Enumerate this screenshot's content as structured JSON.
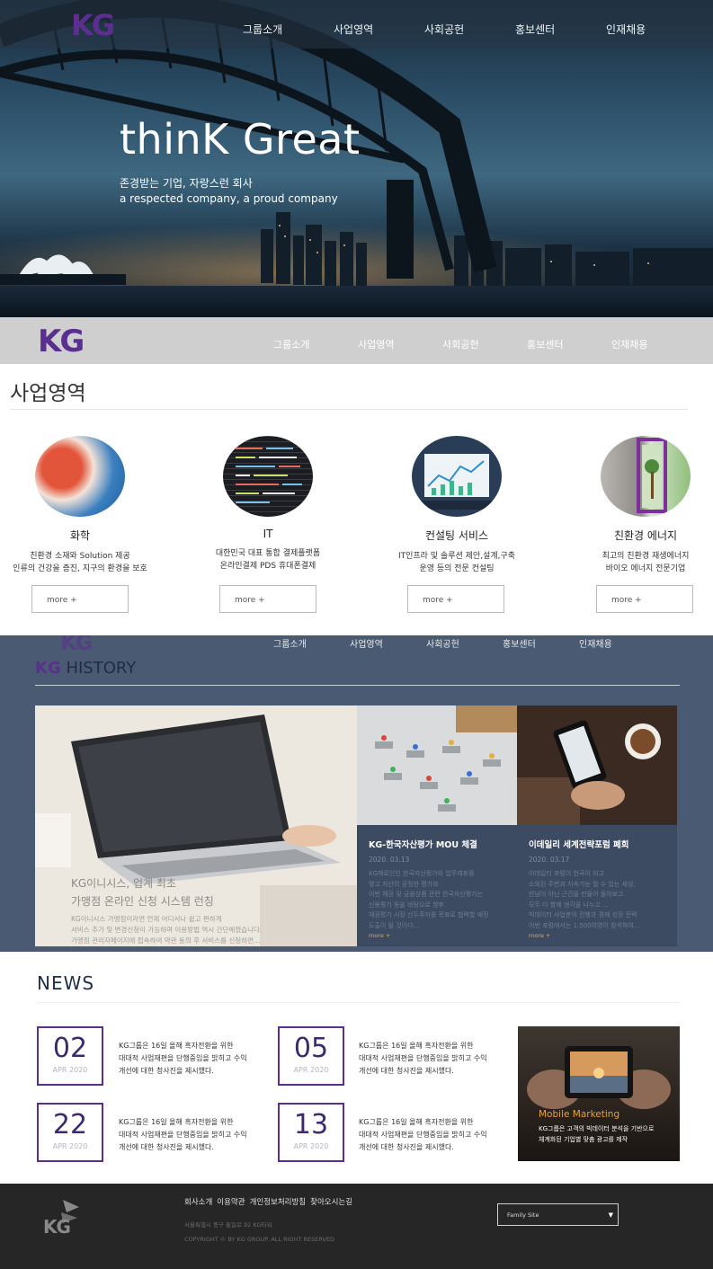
{
  "nav": {
    "logo": "KG",
    "items": [
      "그룹소개",
      "사업영역",
      "사회공헌",
      "홍보센터",
      "인재채용"
    ]
  },
  "hero": {
    "title": "thinK Great",
    "subtitle_ko": "존경받는 기업, 자랑스런 회사",
    "subtitle_en": "a respected company, a proud company"
  },
  "business": {
    "title": "사업영역",
    "items": [
      {
        "name": "화학",
        "desc1": "친환경 소재와 Solution 제공",
        "desc2": "인류의 건강을 증진, 지구의 환경을 보호",
        "more": "more +"
      },
      {
        "name": "IT",
        "desc1": "대한민국 대표 통합 결제플랫폼",
        "desc2": "온라인결제 PDS 휴대폰결제",
        "more": "more +"
      },
      {
        "name": "컨설팅 서비스",
        "desc1": "IT인프라 및 솔루션 제안,설계,구축",
        "desc2": "운영 등의 전문 컨설팅",
        "more": "more +"
      },
      {
        "name": "친환경 에너지",
        "desc1": "최고의 친환경 재생에너지",
        "desc2": "바이오 에너지 전문기업",
        "more": "more +"
      }
    ]
  },
  "history": {
    "title_kg": "KG",
    "title_rest": " HISTORY",
    "main": {
      "title1": "KG이니시스, 업계 최초",
      "title2": "가맹점 온라인 신청 시스템 런칭",
      "text1": "KG이니시스 가맹점이라면 언제 어디서나 쉽고 편하게",
      "text2": "서비스 추가 및 변경신청이 가능하며 이용방법 역시 간단해졌습니다.",
      "text3": "가맹점 관리자페이지에 접속하여 약관 동의 후 서비스를 신청하면..."
    },
    "cards": [
      {
        "title": "KG-한국자산평가 MOU 체결",
        "date": "2020. 03.13",
        "text1": "KG제로인인 한국자산평가와 업무제휴를",
        "text2": "맺고 자산의 공정한 평가와",
        "text3": "이번 채권 및 금융상품 관련 한국자산평가는",
        "text4": "신용평가 등을 바탕으로 향후",
        "text5": "채권평가 시장 선두주자를 목표로 협력할 예정",
        "text6": "도출이 될 것이다...",
        "more": "more +"
      },
      {
        "title": "이데일리 세계전략포럼 폐회",
        "date": "2020. 03.17",
        "text1": "이데일리 포럼이 한국이 되고",
        "text2": "소외된 주변과 지속가능 할 수 있는 세상,",
        "text3": "만남이 아닌 근간을 만들어 돌아보고",
        "text4": "모두 다 함께 생각을 나누고 ...",
        "text5": "빅데이터 사업분야 진행과 경제 성장 전략",
        "text6": "이번 포럼에서는 1,500여명이 참석하여...",
        "more": "more +"
      }
    ]
  },
  "news": {
    "title": "NEWS",
    "items": [
      {
        "day": "02",
        "month": "APR 2020",
        "text1": "KG그룹은 16일 올해 흑자전환을 위한",
        "text2": "대대적 사업재편을 단행중임을 밝히고 수익",
        "text3": "개선에 대한 청사진을 제시했다."
      },
      {
        "day": "05",
        "month": "APR 2020",
        "text1": "KG그룹은 16일 올해 흑자전환을 위한",
        "text2": "대대적 사업재편을 단행중임을 밝히고 수익",
        "text3": "개선에 대한 청사진을 제시했다."
      },
      {
        "day": "22",
        "month": "APR 2020",
        "text1": "KG그룹은 16일 올해 흑자전환을 위한",
        "text2": "대대적 사업재편을 단행중임을 밝히고 수익",
        "text3": "개선에 대한 청사진을 제시했다."
      },
      {
        "day": "13",
        "month": "APR 2020",
        "text1": "KG그룹은 16일 올해 흑자전환을 위한",
        "text2": "대대적 사업재편을 단행중임을 밝히고 수익",
        "text3": "개선에 대한 청사진을 제시했다."
      }
    ],
    "promo": {
      "title": "Mobile Marketing",
      "text1": "KG그룹은 고객의 빅데이터 분석을 기반으로",
      "text2": "체계화된 기업별 맞춤 광고를 제작"
    }
  },
  "footer": {
    "logo": "KG",
    "links": [
      "회사소개",
      "이용약관",
      "개인정보처리방침",
      "찾아오시는길"
    ],
    "address": "서울특별시 중구 통일로 92 KG타워",
    "copyright": "COPYRIGHT © BY KG GROUP. ALL RIGHT RESERVED",
    "family_site": "Family Site"
  },
  "colors": {
    "brand_purple": "#5b2f8f",
    "history_bg": "#4a5a72",
    "footer_bg": "#262626",
    "accent_orange": "#e6a03b"
  }
}
